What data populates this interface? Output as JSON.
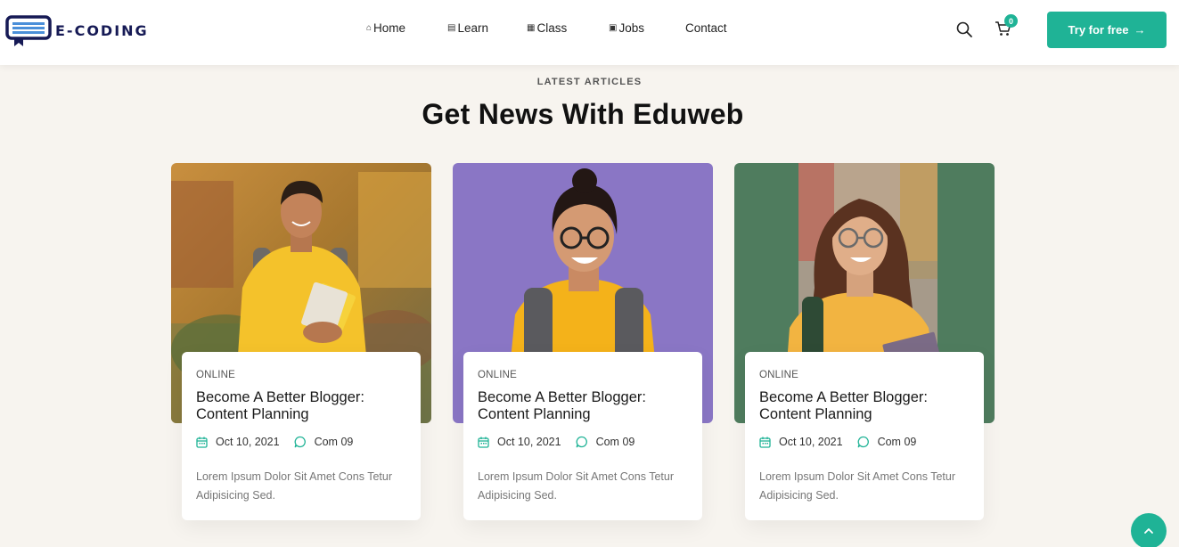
{
  "brand": {
    "name": "E-CODING"
  },
  "nav": [
    {
      "label": "Home",
      "icon": "home-icon"
    },
    {
      "label": "Learn",
      "icon": "book-icon"
    },
    {
      "label": "Class",
      "icon": "class-icon"
    },
    {
      "label": "Jobs",
      "icon": "briefcase-icon"
    },
    {
      "label": "Contact",
      "icon": ""
    }
  ],
  "header": {
    "cart_count": "0",
    "cta_label": "Try for free"
  },
  "section": {
    "eyebrow": "LATEST ARTICLES",
    "title": "Get News With Eduweb"
  },
  "articles": [
    {
      "tag": "ONLINE",
      "title": "Become A Better Blogger: Content Planning",
      "date": "Oct 10, 2021",
      "comments": "Com 09",
      "excerpt": "Lorem Ipsum Dolor Sit Amet Cons Tetur Adipisicing Sed."
    },
    {
      "tag": "ONLINE",
      "title": "Become A Better Blogger: Content Planning",
      "date": "Oct 10, 2021",
      "comments": "Com 09",
      "excerpt": "Lorem Ipsum Dolor Sit Amet Cons Tetur Adipisicing Sed."
    },
    {
      "tag": "ONLINE",
      "title": "Become A Better Blogger: Content Planning",
      "date": "Oct 10, 2021",
      "comments": "Com 09",
      "excerpt": "Lorem Ipsum Dolor Sit Amet Cons Tetur Adipisicing Sed."
    }
  ],
  "colors": {
    "accent": "#1fb396",
    "brand": "#161a55",
    "background": "#f7f4ef"
  }
}
